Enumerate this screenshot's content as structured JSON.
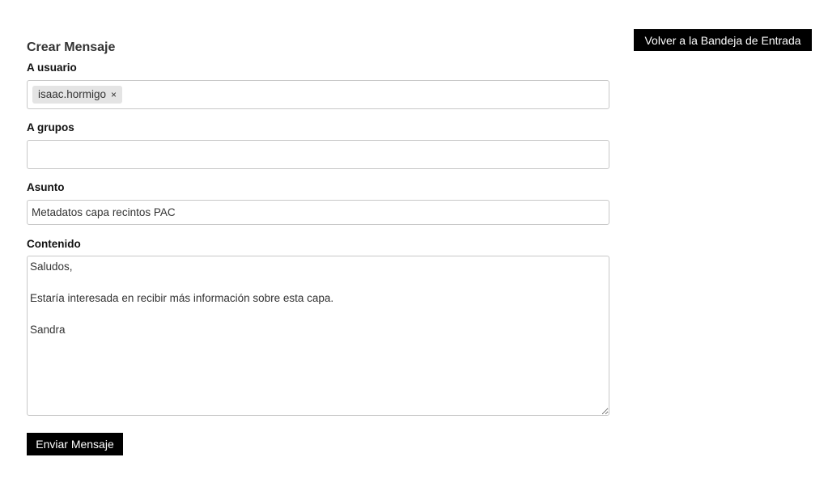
{
  "header": {
    "back_button_label": "Volver a la Bandeja de Entrada"
  },
  "form": {
    "title": "Crear Mensaje",
    "to_user": {
      "label": "A usuario",
      "tags": [
        {
          "value": "isaac.hormigo",
          "remove_glyph": "×"
        }
      ]
    },
    "to_groups": {
      "label": "A grupos",
      "tags": []
    },
    "subject": {
      "label": "Asunto",
      "value": "Metadatos capa recintos PAC"
    },
    "content": {
      "label": "Contenido",
      "value": "Saludos,\n\nEstaría interesada en recibir más información sobre esta capa.\n\nSandra"
    },
    "submit_label": "Enviar Mensaje"
  },
  "colors": {
    "button_bg": "#000000",
    "button_text": "#ffffff",
    "border": "#c8c8c8",
    "tag_bg": "#e4e4e4"
  }
}
